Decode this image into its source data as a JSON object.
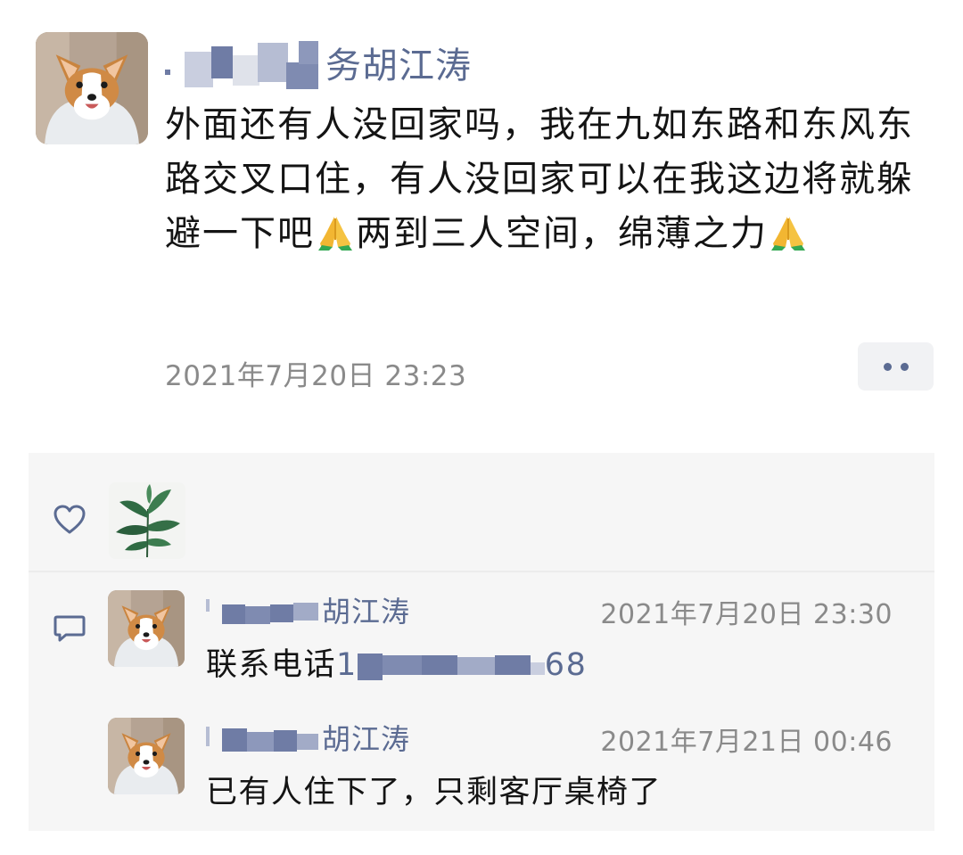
{
  "post": {
    "author_visible": "胡江涛",
    "author_partial_char": "务",
    "content_segments": [
      "外面还有人没回家吗，我在九如东路和东风东路交叉口住，有人没回家可以在我这边将就躲避一下吧",
      "两到三人空间，绵薄之力"
    ],
    "emoji": "folded-hands",
    "timestamp": "2021年7月20日 23:23",
    "more_icon": "more-dots-icon"
  },
  "interactions": {
    "like_icon": "heart-outline-icon",
    "comment_icon": "comment-bubble-icon",
    "liker_avatar": "plant-photo"
  },
  "comments": [
    {
      "author_visible": "胡江涛",
      "time": "2021年7月20日 23:30",
      "text_prefix": "联系电话",
      "phone_start": "1",
      "phone_end": "68"
    },
    {
      "author_visible": "胡江涛",
      "time": "2021年7月21日 00:46",
      "text": "已有人住下了，只剩客厅桌椅了"
    }
  ],
  "colors": {
    "name_blue": "#5b6b92",
    "timestamp_gray": "#8a8a8a",
    "panel_bg": "#f6f6f6",
    "mosaic_light": "#c9cedf",
    "mosaic_dark": "#6f7ca5"
  }
}
